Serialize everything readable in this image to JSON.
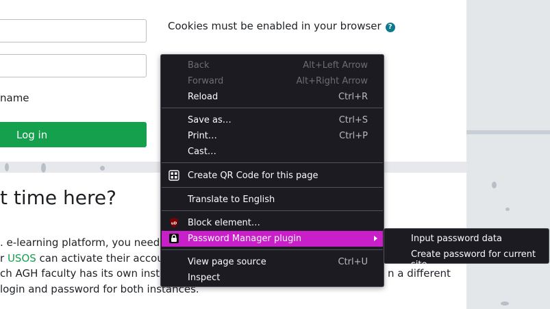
{
  "login": {
    "remember_label": "name",
    "login_button": "Log in",
    "cookies_text": "Cookies must be enabled in your browser",
    "help_glyph": "?"
  },
  "intro": {
    "heading": "t time here?",
    "line1": ". e-learning platform, you need to be",
    "line2_pre": "r ",
    "line2_link": "USOS",
    "line2_post": " can activate their account in",
    "line3": "ch AGH faculty has its own instance",
    "line3_tail": "n a different",
    "line4": "login and password for both instances."
  },
  "context_menu": {
    "back": "Back",
    "back_shortcut": "Alt+Left Arrow",
    "forward": "Forward",
    "forward_shortcut": "Alt+Right Arrow",
    "reload": "Reload",
    "reload_shortcut": "Ctrl+R",
    "save_as": "Save as…",
    "save_as_shortcut": "Ctrl+S",
    "print": "Print…",
    "print_shortcut": "Ctrl+P",
    "cast": "Cast…",
    "qr": "Create QR Code for this page",
    "translate": "Translate to English",
    "block": "Block element…",
    "password_manager": "Password Manager plugin",
    "view_source": "View page source",
    "view_source_shortcut": "Ctrl+U",
    "inspect": "Inspect"
  },
  "submenu": {
    "input_password": "Input password data",
    "create_password": "Create password for current site"
  },
  "colors": {
    "accent_green": "#15a04d",
    "menu_highlight": "#c91fc9",
    "menu_bg": "#1c1b22"
  },
  "icons": {
    "help": "help-circle-icon",
    "qr": "qr-code-icon",
    "ublock": "ublock-shield-icon",
    "password": "lock-icon",
    "submenu": "chevron-right-icon"
  }
}
